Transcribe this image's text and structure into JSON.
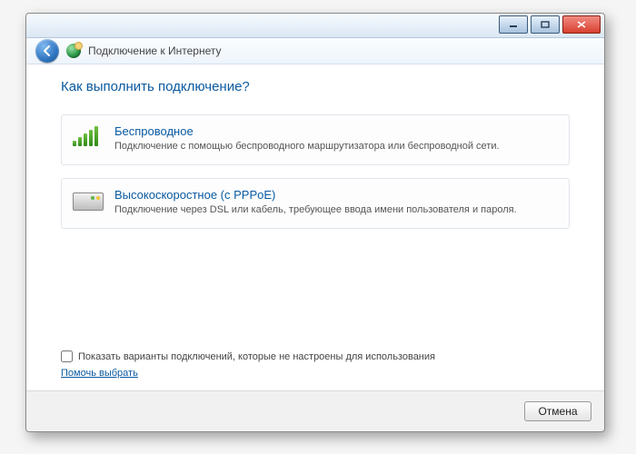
{
  "window": {
    "title": "Подключение к Интернету"
  },
  "page": {
    "question": "Как выполнить подключение?"
  },
  "options": {
    "wireless": {
      "title": "Беспроводное",
      "desc": "Подключение с помощью беспроводного маршрутизатора или беспроводной сети."
    },
    "pppoe": {
      "title": "Высокоскоростное (с PPPoE)",
      "desc": "Подключение через DSL или кабель, требующее ввода имени пользователя и пароля."
    }
  },
  "lower": {
    "checkbox_label": "Показать варианты подключений, которые не настроены для использования",
    "help_link": "Помочь выбрать"
  },
  "footer": {
    "cancel": "Отмена"
  }
}
